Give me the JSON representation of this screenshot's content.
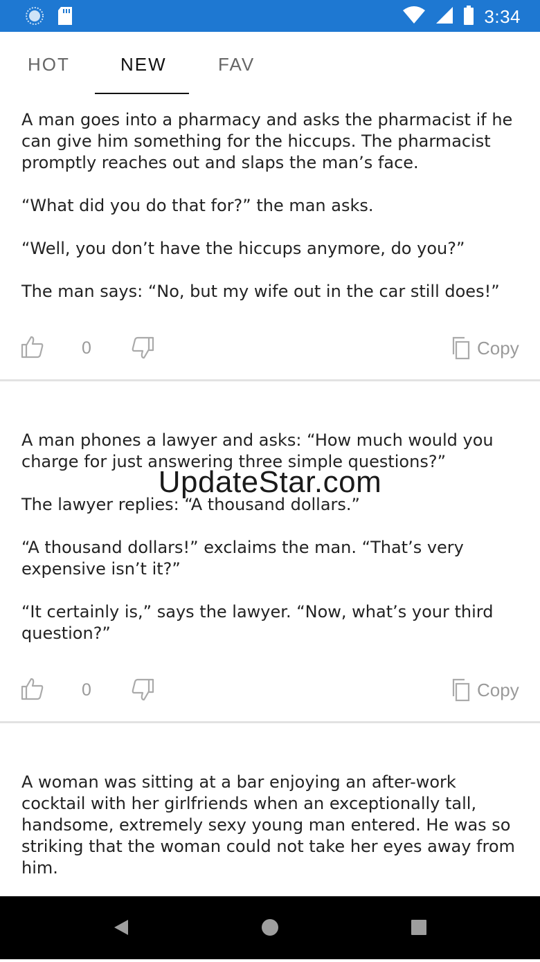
{
  "status": {
    "time": "3:34"
  },
  "tabs": [
    {
      "label": "HOT"
    },
    {
      "label": "NEW",
      "active": true
    },
    {
      "label": "FAV"
    }
  ],
  "jokes": [
    {
      "text": "A man goes into a pharmacy and asks the pharmacist if he can give him something for the hiccups. The pharmacist promptly reaches out and slaps the man’s face.\n\n“What did you do that for?” the man asks.\n\n“Well, you don’t have the hiccups anymore, do you?”\n\nThe man says: “No, but my wife out in the car still does!”",
      "likes": "0",
      "copy_label": "Copy"
    },
    {
      "text": "A man phones a lawyer and asks: “How much would you charge for just answering three simple questions?”\n\nThe lawyer replies: “A thousand dollars.”\n\n“A thousand dollars!” exclaims the man. “That’s very expensive isn’t it?”\n\n“It certainly is,” says the lawyer. “Now, what’s your third question?”",
      "likes": "0",
      "copy_label": "Copy"
    },
    {
      "text": "A woman was sitting at a bar enjoying an after-work cocktail with her girlfriends when an exceptionally tall, handsome, extremely sexy young man entered. He was so striking that the woman could not take her eyes away from him.\n\nThe young man noticed her overly attentive stare and walked"
    }
  ],
  "watermark": "UpdateStar.com",
  "colors": {
    "status_bar": "#1e78d2",
    "nav_bar": "#000000",
    "icon_gray": "#aaaaaa"
  }
}
